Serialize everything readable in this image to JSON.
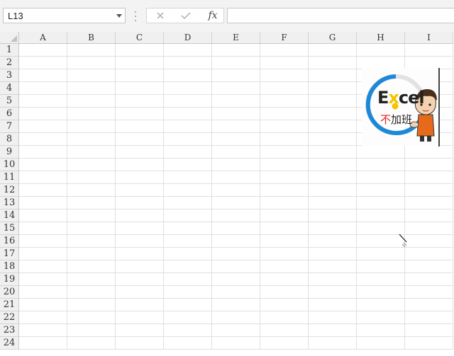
{
  "formula_bar": {
    "name_box": "L13",
    "fx_label": "fx",
    "formula": ""
  },
  "columns": [
    "A",
    "B",
    "C",
    "D",
    "E",
    "F",
    "G",
    "H",
    "I"
  ],
  "rows": [
    "1",
    "2",
    "3",
    "4",
    "5",
    "6",
    "7",
    "8",
    "9",
    "10",
    "11",
    "12",
    "13",
    "14",
    "15",
    "16",
    "17",
    "18",
    "19",
    "20",
    "21",
    "22",
    "23",
    "24"
  ],
  "logo": {
    "text_en": "Excel",
    "text_cn": "不加班",
    "colors": {
      "ring": "#1e88d8",
      "red": "#e8211b",
      "yellow": "#f5c400",
      "dark": "#222222"
    }
  }
}
